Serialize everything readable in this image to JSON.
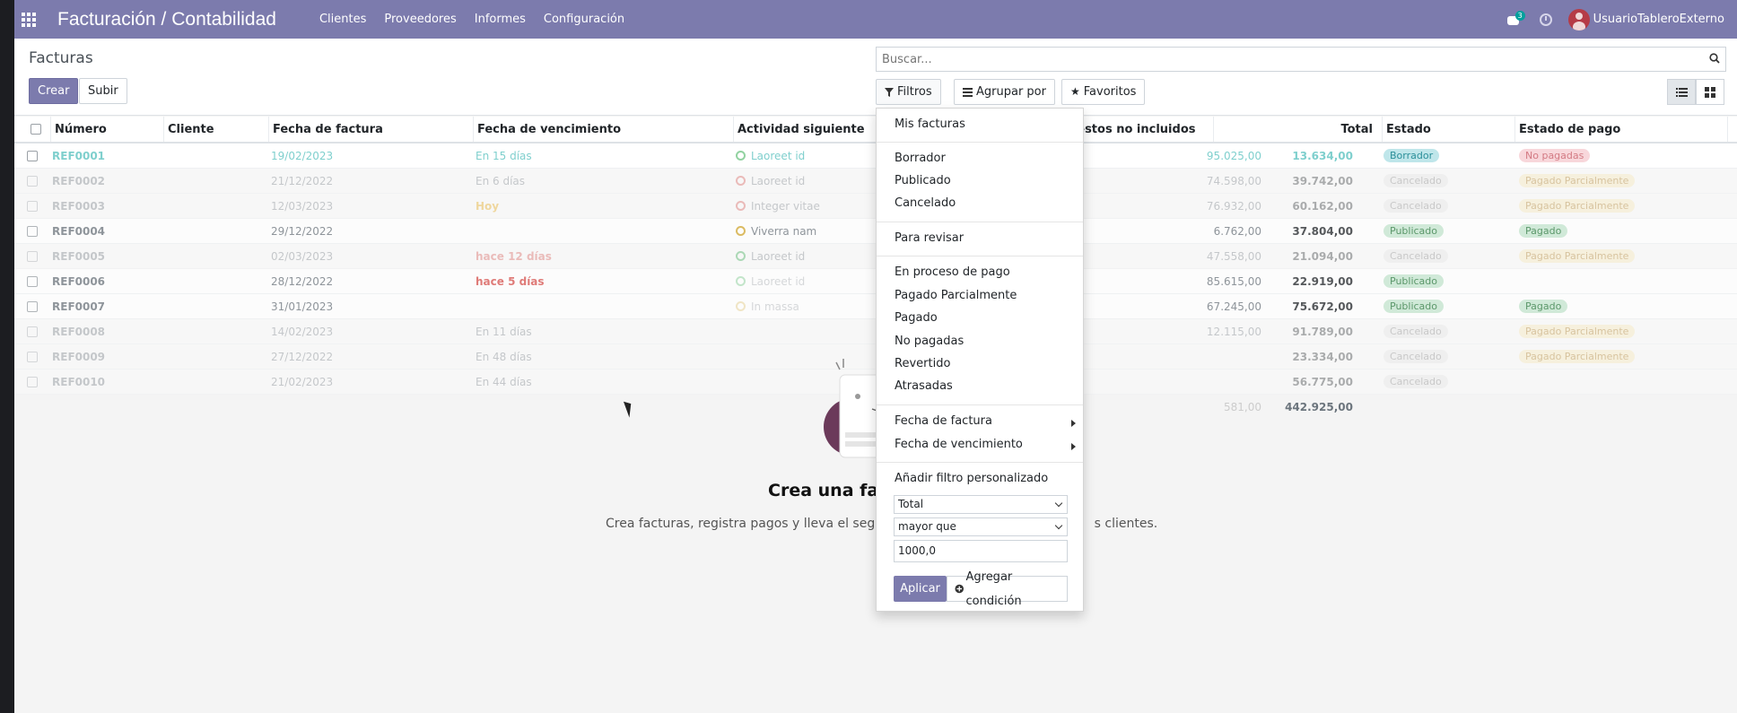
{
  "app": {
    "title": "Facturación / Contabilidad"
  },
  "nav": {
    "menu": [
      "Clientes",
      "Proveedores",
      "Informes",
      "Configuración"
    ],
    "chat_count": "3",
    "user": "UsuarioTableroExterno"
  },
  "page": {
    "breadcrumb": "Facturas",
    "create_label": "Crear",
    "upload_label": "Subir"
  },
  "search": {
    "placeholder": "Buscar..."
  },
  "filters": {
    "filters_label": "Filtros",
    "groupby_label": "Agrupar por",
    "favorites_label": "Favoritos"
  },
  "columns": [
    "Número",
    "Cliente",
    "Fecha de factura",
    "Fecha de vencimiento",
    "Actividad siguiente",
    "uestos no incluidos",
    "Total",
    "Estado",
    "Estado de pago"
  ],
  "rows": [
    {
      "num": "REF0001",
      "fecha": "19/02/2023",
      "venc": "En 15 días",
      "act": "Laoreet id",
      "imp": "95.025,00",
      "total": "13.634,00",
      "estado": "Borrador",
      "pago": "No pagadas"
    },
    {
      "num": "REF0002",
      "fecha": "21/12/2022",
      "venc": "En 6 días",
      "act": "Laoreet id",
      "imp": "74.598,00",
      "total": "39.742,00",
      "estado": "Cancelado",
      "pago": "Pagado Parcialmente"
    },
    {
      "num": "REF0003",
      "fecha": "12/03/2023",
      "venc": "Hoy",
      "act": "Integer vitae",
      "imp": "76.932,00",
      "total": "60.162,00",
      "estado": "Cancelado",
      "pago": "Pagado Parcialmente"
    },
    {
      "num": "REF0004",
      "fecha": "29/12/2022",
      "venc": "",
      "act": "Viverra nam",
      "imp": "6.762,00",
      "total": "37.804,00",
      "estado": "Publicado",
      "pago": "Pagado"
    },
    {
      "num": "REF0005",
      "fecha": "02/03/2023",
      "venc": "hace 12 días",
      "act": "Laoreet id",
      "imp": "47.558,00",
      "total": "21.094,00",
      "estado": "Cancelado",
      "pago": "Pagado Parcialmente"
    },
    {
      "num": "REF0006",
      "fecha": "28/12/2022",
      "venc": "hace 5 días",
      "act": "Laoreet id",
      "imp": "85.615,00",
      "total": "22.919,00",
      "estado": "Publicado",
      "pago": ""
    },
    {
      "num": "REF0007",
      "fecha": "31/01/2023",
      "venc": "",
      "act": "In massa",
      "imp": "67.245,00",
      "total": "75.672,00",
      "estado": "Publicado",
      "pago": "Pagado"
    },
    {
      "num": "REF0008",
      "fecha": "14/02/2023",
      "venc": "En 11 días",
      "act": "",
      "imp": "12.115,00",
      "total": "91.789,00",
      "estado": "Cancelado",
      "pago": "Pagado Parcialmente"
    },
    {
      "num": "REF0009",
      "fecha": "27/12/2022",
      "venc": "En 48 días",
      "act": "",
      "imp": "",
      "total": "23.334,00",
      "estado": "Cancelado",
      "pago": "Pagado Parcialmente"
    },
    {
      "num": "REF0010",
      "fecha": "21/02/2023",
      "venc": "En 44 días",
      "act": "",
      "imp": "",
      "total": "56.775,00",
      "estado": "Cancelado",
      "pago": ""
    }
  ],
  "totals": {
    "imp": "581,00",
    "total": "442.925,00"
  },
  "helper": {
    "title": "Crea una fact",
    "text": "Crea facturas, registra pagos y lleva el seguim                                                 s clientes."
  },
  "dropdown": {
    "items": [
      "Mis facturas",
      "Borrador",
      "Publicado",
      "Cancelado",
      "Para revisar",
      "En proceso de pago",
      "Pagado Parcialmente",
      "Pagado",
      "No pagadas",
      "Revertido",
      "Atrasadas",
      "Fecha de factura",
      "Fecha de vencimiento",
      "Añadir filtro personalizado"
    ],
    "field": "Total",
    "operator": "mayor que",
    "value": "1000,0",
    "apply_label": "Aplicar",
    "add_condition_label": "Agregar condición"
  },
  "colors": {
    "brand": "#7c7bad",
    "danger": "#d9534f",
    "warning": "#e8a200"
  }
}
